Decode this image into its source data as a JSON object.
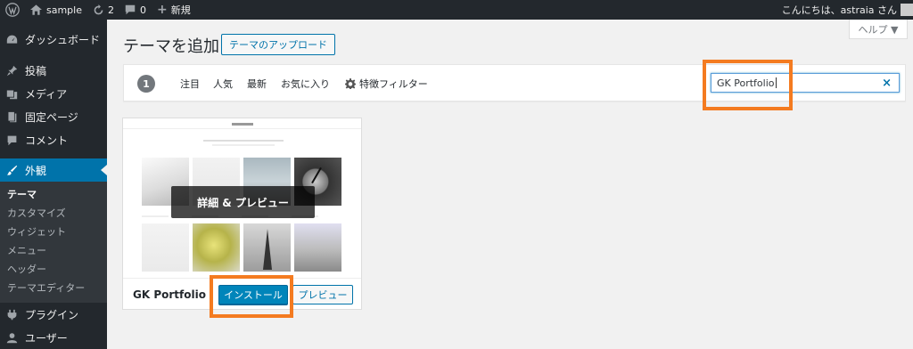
{
  "admin_bar": {
    "site_name": "sample",
    "updates_count": "2",
    "comments_count": "0",
    "new_label": "新規",
    "greeting": "こんにちは、astraia さん"
  },
  "sidebar": {
    "items": [
      {
        "label": "ダッシュボード",
        "icon": "dashboard-icon"
      },
      {
        "label": "投稿",
        "icon": "pin-icon"
      },
      {
        "label": "メディア",
        "icon": "media-icon"
      },
      {
        "label": "固定ページ",
        "icon": "page-icon"
      },
      {
        "label": "コメント",
        "icon": "comment-icon"
      },
      {
        "label": "外観",
        "icon": "brush-icon"
      }
    ],
    "submenu": [
      "テーマ",
      "カスタマイズ",
      "ウィジェット",
      "メニュー",
      "ヘッダー",
      "テーマエディター"
    ],
    "bottom_items": [
      {
        "label": "プラグイン",
        "icon": "plugin-icon"
      },
      {
        "label": "ユーザー",
        "icon": "user-icon"
      }
    ]
  },
  "help_label": "ヘルプ ▼",
  "page": {
    "title": "テーマを追加",
    "upload_label": "テーマのアップロード"
  },
  "filter": {
    "count": "1",
    "links": [
      "注目",
      "人気",
      "最新",
      "お気に入り"
    ],
    "feature_filter": "特徴フィルター",
    "search_value": "GK Portfolio",
    "clear_symbol": "×"
  },
  "theme": {
    "name": "GK Portfolio",
    "overlay_label": "詳細 & プレビュー",
    "install_label": "インストール",
    "preview_label": "プレビュー"
  },
  "colors": {
    "accent": "#0073aa",
    "highlight": "#f47b20",
    "admin_bg": "#23282d"
  }
}
